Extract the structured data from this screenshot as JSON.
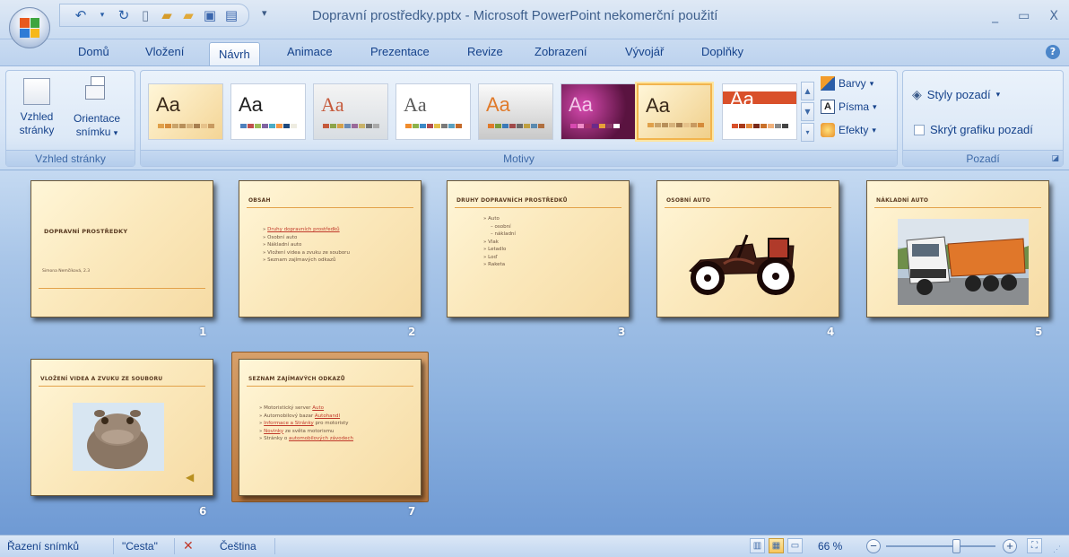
{
  "window": {
    "title": "Dopravní prostředky.pptx - Microsoft PowerPoint nekomerční použití",
    "controls": [
      "_",
      "▭",
      "X"
    ]
  },
  "qat": {
    "icons": [
      "undo-icon",
      "undo-dropdown-icon",
      "redo-icon",
      "new-icon",
      "open-icon",
      "open-folder-icon",
      "save-icon",
      "print-preview-icon"
    ]
  },
  "tabs": [
    {
      "label": "Domů"
    },
    {
      "label": "Vložení"
    },
    {
      "label": "Návrh",
      "active": true
    },
    {
      "label": "Animace"
    },
    {
      "label": "Prezentace"
    },
    {
      "label": "Revize"
    },
    {
      "label": "Zobrazení"
    },
    {
      "label": "Vývojář"
    },
    {
      "label": "Doplňky"
    }
  ],
  "ribbon": {
    "page_setup": {
      "group_label": "Vzhled stránky",
      "page_setup_btn": "Vzhled stránky",
      "orientation_btn": "Orientace snímku",
      "orientation_arrow": "▾"
    },
    "themes": {
      "group_label": "Motivy",
      "aa": "Aa",
      "colors": "Barvy",
      "fonts": "Písma",
      "effects": "Efekty",
      "arrow": "▾"
    },
    "background": {
      "group_label": "Pozadí",
      "styles": "Styly pozadí",
      "hide_graphics": "Skrýt grafiku pozadí",
      "arrow": "▾"
    }
  },
  "slides": [
    {
      "number": "1",
      "title": "DOPRAVNÍ PROSTŘEDKY",
      "subtitle": "Simona Nemčíková, 2.3"
    },
    {
      "number": "2",
      "title": "OBSAH",
      "items": [
        "Druhy dopravních prostředků",
        "Osobní auto",
        "Nákladní auto",
        "Vložení videa a zvuku ze souboru",
        "Seznam zajímavých odkazů"
      ]
    },
    {
      "number": "3",
      "title": "DRUHY DOPRAVNÍCH PROSTŘEDKŮ",
      "items": [
        "Auto",
        "osobní",
        "nákladní",
        "Vlak",
        "Letadlo",
        "Loď",
        "Raketa"
      ]
    },
    {
      "number": "4",
      "title": "OSOBNÍ AUTO"
    },
    {
      "number": "5",
      "title": "NÁKLADNÍ AUTO"
    },
    {
      "number": "6",
      "title": "VLOŽENÍ VIDEA A ZVUKU ZE SOUBORU"
    },
    {
      "number": "7",
      "title": "SEZNAM ZAJÍMAVÝCH ODKAZŮ",
      "items": [
        {
          "pre": "Motoristický server ",
          "link": "Auto",
          "post": ""
        },
        {
          "pre": "Automobilový bazar ",
          "link": "Autohandl",
          "post": ""
        },
        {
          "pre": "",
          "link": "Informace a Stránky",
          "post": " pro motoristy"
        },
        {
          "pre": "",
          "link": "Novinky",
          "post": " ze světa motorismu"
        },
        {
          "pre": "Stránky o ",
          "link": "automobilových závodech",
          "post": ""
        }
      ]
    }
  ],
  "status": {
    "view": "Řazení snímků",
    "theme": "\"Cesta\"",
    "language": "Čeština",
    "zoom": "66 %"
  },
  "colors": {
    "ribbon": "#dde9f7",
    "sorter_bg": "#8eb3e0",
    "slide_bg": "#fbe9bd",
    "accent": "#e3a24a"
  }
}
